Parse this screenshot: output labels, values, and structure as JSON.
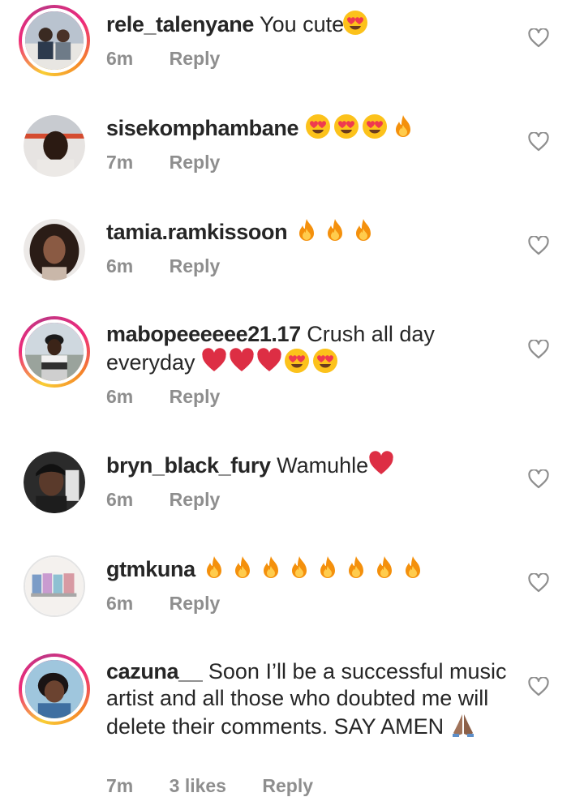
{
  "comments": [
    {
      "username": "rele_talenyane",
      "text": "You cute",
      "emojis": [
        "heart-eyes"
      ],
      "time": "6m",
      "likes": "",
      "reply": "Reply"
    },
    {
      "username": "sisekomphambane",
      "text": "",
      "emojis": [
        "heart-eyes",
        "heart-eyes",
        "heart-eyes",
        "fire"
      ],
      "time": "7m",
      "likes": "",
      "reply": "Reply"
    },
    {
      "username": "tamia.ramkissoon",
      "text": "",
      "emojis": [
        "fire",
        "fire",
        "fire"
      ],
      "time": "6m",
      "likes": "",
      "reply": "Reply"
    },
    {
      "username": "mabopeeeeee21.17",
      "text": "Crush all day everyday",
      "emojis": [
        "red-heart",
        "red-heart",
        "red-heart",
        "heart-eyes",
        "heart-eyes"
      ],
      "time": "6m",
      "likes": "",
      "reply": "Reply"
    },
    {
      "username": "bryn_black_fury",
      "text": "Wamuhle",
      "emojis": [
        "red-heart"
      ],
      "time": "6m",
      "likes": "",
      "reply": "Reply"
    },
    {
      "username": "gtmkuna",
      "text": "",
      "emojis": [
        "fire",
        "fire",
        "fire",
        "fire",
        "fire",
        "fire",
        "fire",
        "fire"
      ],
      "time": "6m",
      "likes": "",
      "reply": "Reply"
    },
    {
      "username": "cazuna__",
      "text": "Soon I’ll be a successful music artist and all those who doubted me will delete their comments. SAY AMEN",
      "emojis": [
        "folded-hands"
      ],
      "time": "7m",
      "likes": "3 likes",
      "reply": "Reply"
    }
  ],
  "colors": {
    "text": "#262626",
    "meta": "#8e8e8e",
    "story_ring_start": "#f9ce34",
    "story_ring_mid": "#ee2a7b",
    "story_ring_end": "#c13584"
  },
  "icons": {
    "like": "heart-outline-icon",
    "emoji_heart_eyes": "heart-eyes-emoji",
    "emoji_fire": "fire-emoji",
    "emoji_red_heart": "red-heart-emoji",
    "emoji_folded_hands": "folded-hands-emoji"
  }
}
